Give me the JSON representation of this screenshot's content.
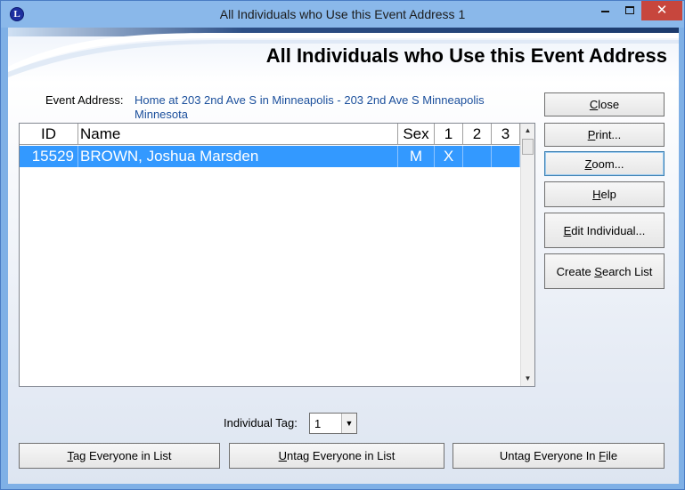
{
  "window": {
    "title": "All Individuals who Use this Event Address 1",
    "app_icon_letter": "L",
    "close_glyph": "✕"
  },
  "banner": {
    "title": "All Individuals who Use this Event Address"
  },
  "event_address": {
    "label": "Event Address:",
    "value": "Home at 203 2nd Ave S in Minneapolis - 203 2nd Ave S  Minneapolis Minnesota"
  },
  "list": {
    "columns": [
      "ID",
      "Name",
      "Sex",
      "1",
      "2",
      "3"
    ],
    "rows": [
      {
        "id": "15529",
        "name": "BROWN, Joshua Marsden",
        "sex": "M",
        "c1": "X",
        "c2": "",
        "c3": ""
      }
    ]
  },
  "buttons": {
    "close": {
      "accel": "C",
      "rest": "lose"
    },
    "print": {
      "accel": "P",
      "rest": "rint..."
    },
    "zoom": {
      "accel": "Z",
      "rest": "oom..."
    },
    "help": {
      "accel": "H",
      "rest": "elp"
    },
    "edit_individual": {
      "accel": "E",
      "rest": "dit Individual..."
    },
    "create_search_list": {
      "pre": "Create ",
      "accel": "S",
      "rest": "earch List"
    },
    "tag_everyone": {
      "accel": "T",
      "rest": "ag Everyone in List"
    },
    "untag_everyone_list": {
      "accel": "U",
      "rest": "ntag Everyone in List"
    },
    "untag_everyone_file": {
      "pre": "Untag Everyone In ",
      "accel": "F",
      "rest": "ile"
    }
  },
  "individual_tag": {
    "label": "Individual Tag:",
    "value": "1"
  },
  "colors": {
    "selection": "#3399ff",
    "address_text": "#1b4f9c",
    "close_button": "#c7463d"
  },
  "icons": {
    "minimize": "minimize-icon",
    "maximize": "maximize-icon",
    "close": "close-icon",
    "scroll_up": "triangle-up-icon",
    "scroll_down": "triangle-down-icon",
    "dropdown": "triangle-down-icon"
  }
}
